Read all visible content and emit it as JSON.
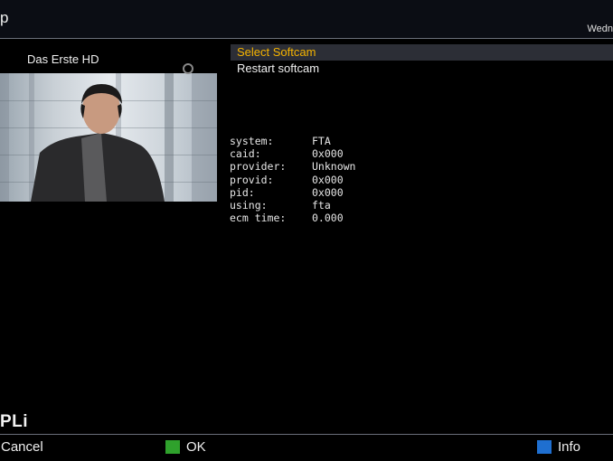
{
  "header": {
    "title": "p",
    "date": "Wedn"
  },
  "preview": {
    "channel": "Das Erste HD"
  },
  "menu": {
    "items": [
      {
        "label": "Select Softcam",
        "selected": true
      },
      {
        "label": "Restart softcam",
        "selected": false
      }
    ]
  },
  "info": {
    "rows": [
      {
        "key": "system:",
        "value": "FTA"
      },
      {
        "key": "caid:",
        "value": "0x000"
      },
      {
        "key": "provider:",
        "value": "Unknown"
      },
      {
        "key": "provid:",
        "value": "0x000"
      },
      {
        "key": "pid:",
        "value": "0x000"
      },
      {
        "key": "using:",
        "value": "fta"
      },
      {
        "key": "ecm time:",
        "value": "0.000"
      }
    ]
  },
  "branding": {
    "logo": "PLi"
  },
  "footer": {
    "cancel_label": "Cancel",
    "ok_label": "OK",
    "info_label": "Info",
    "ok_color": "#2fa12c",
    "info_color": "#1f6fd0"
  },
  "colors": {
    "accent": "#f6b400",
    "selected_bg": "#2c2e36"
  }
}
